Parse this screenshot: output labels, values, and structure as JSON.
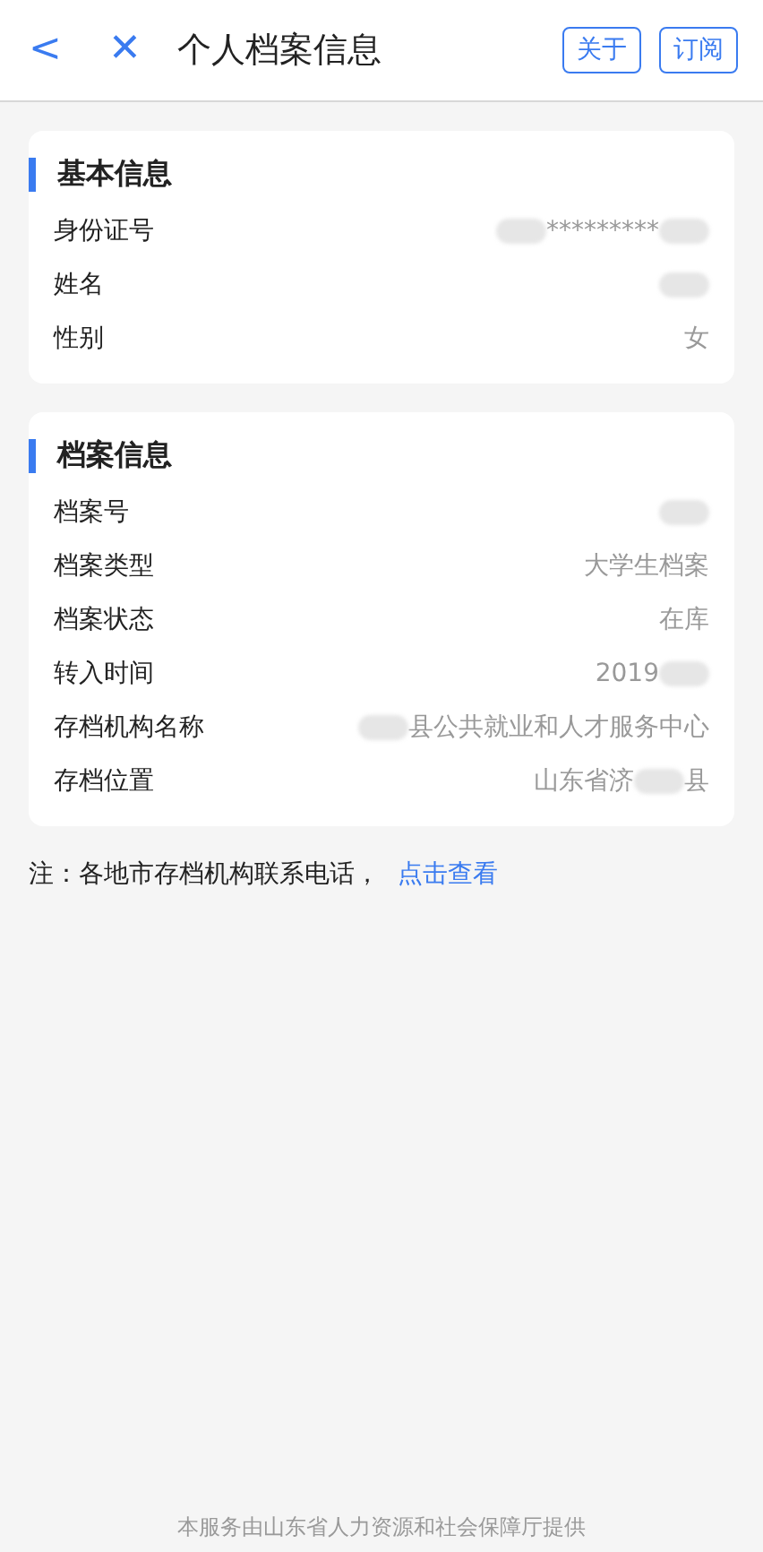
{
  "header": {
    "back": "<",
    "close": "✕",
    "title": "个人档案信息",
    "buttons": [
      "关于",
      "订阅"
    ]
  },
  "sections": [
    {
      "title": "基本信息",
      "rows": [
        {
          "label": "身份证号",
          "value": [
            {
              "kind": "blur"
            },
            {
              "kind": "text",
              "text": "*********"
            },
            {
              "kind": "blur"
            }
          ]
        },
        {
          "label": "姓名",
          "value": [
            {
              "kind": "blur"
            }
          ]
        },
        {
          "label": "性别",
          "value": [
            {
              "kind": "text",
              "text": "女"
            }
          ]
        }
      ]
    },
    {
      "title": "档案信息",
      "rows": [
        {
          "label": "档案号",
          "value": [
            {
              "kind": "blur"
            }
          ]
        },
        {
          "label": "档案类型",
          "value": [
            {
              "kind": "text",
              "text": "大学生档案"
            }
          ]
        },
        {
          "label": "档案状态",
          "value": [
            {
              "kind": "text",
              "text": "在库"
            }
          ]
        },
        {
          "label": "转入时间",
          "value": [
            {
              "kind": "text",
              "text": "2019"
            },
            {
              "kind": "blur"
            }
          ]
        },
        {
          "label": "存档机构名称",
          "value": [
            {
              "kind": "blur"
            },
            {
              "kind": "text",
              "text": "县公共就业和人才服务中心"
            }
          ]
        },
        {
          "label": "存档位置",
          "value": [
            {
              "kind": "text",
              "text": "山东省济"
            },
            {
              "kind": "blur"
            },
            {
              "kind": "text",
              "text": "县"
            }
          ]
        }
      ]
    }
  ],
  "note": {
    "text": "注：各地市存档机构联系电话，",
    "link": "点击查看"
  },
  "footer": "本服务由山东省人力资源和社会保障厅提供"
}
